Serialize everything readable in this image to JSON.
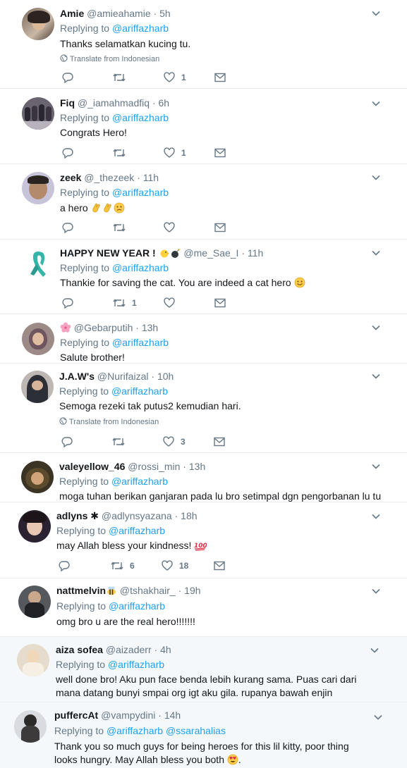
{
  "tweets": [
    {
      "name": "Amie",
      "handle": "@amieahamie",
      "time": "5h",
      "replying_label": "Replying to",
      "replying_to": "@ariffazharb",
      "text": "Thanks selamatkan kucing tu.",
      "translate": "Translate from Indonesian",
      "replies": "",
      "retweets": "",
      "likes": "1"
    },
    {
      "name": "Fiq",
      "handle": "@_iamahmadfiq",
      "time": "6h",
      "replying_label": "Replying to",
      "replying_to": "@ariffazharb",
      "text": "Congrats Hero!",
      "translate": "",
      "replies": "",
      "retweets": "",
      "likes": "1"
    },
    {
      "name": "zeek",
      "handle": "@_thezeek",
      "time": "11h",
      "replying_label": "Replying to",
      "replying_to": "@ariffazharb",
      "text": "a hero",
      "translate": "",
      "replies": "",
      "retweets": "",
      "likes": ""
    },
    {
      "name": "HAPPY NEW YEAR !",
      "handle": "@me_Sae_I",
      "time": "11h",
      "replying_label": "Replying to",
      "replying_to": "@ariffazharb",
      "text": "Thankie for saving the cat. You are indeed a cat hero",
      "translate": "",
      "replies": "",
      "retweets": "1",
      "likes": ""
    },
    {
      "name": "",
      "handle": "@Gebarputih",
      "time": "13h",
      "replying_label": "Replying to",
      "replying_to": "@ariffazharb",
      "text": "Salute brother!",
      "translate": "",
      "replies": "",
      "retweets": "",
      "likes": ""
    },
    {
      "name": "J.A.W's",
      "handle": "@Nurifaizal",
      "time": "10h",
      "replying_label": "Replying to",
      "replying_to": "@ariffazharb",
      "text": "Semoga rezeki tak putus2 kemudian hari.",
      "translate": "Translate from Indonesian",
      "replies": "",
      "retweets": "",
      "likes": "3"
    },
    {
      "name": "valeyellow_46",
      "handle": "@rossi_min",
      "time": "13h",
      "replying_label": "Replying to",
      "replying_to": "@ariffazharb",
      "text": "moga tuhan berikan ganjaran pada lu bro setimpal dgn pengorbanan lu tu",
      "translate": "",
      "replies": "",
      "retweets": "",
      "likes": ""
    },
    {
      "name": "adlyns",
      "handle": "@adlynsyazana",
      "time": "18h",
      "replying_label": "Replying to",
      "replying_to": "@ariffazharb",
      "text": "may Allah bless your kindness!",
      "translate": "",
      "replies": "",
      "retweets": "6",
      "likes": "18"
    },
    {
      "name": "nattmelvin",
      "handle": "@tshakhair_",
      "time": "19h",
      "replying_label": "Replying to",
      "replying_to": "@ariffazharb",
      "text": "omg bro u are the real hero!!!!!!!",
      "translate": "",
      "replies": "",
      "retweets": "",
      "likes": ""
    },
    {
      "name": "aiza sofea",
      "handle": "@aizaderr",
      "time": "4h",
      "replying_label": "Replying to",
      "replying_to": "@ariffazharb",
      "text": "well done bro! Aku pun face benda lebih kurang sama. Puas cari dari mana datang bunyi smpai org igt aku gila. rupanya bawah enjin",
      "translate": "",
      "replies": "",
      "retweets": "",
      "likes": ""
    },
    {
      "name": "puffercAt",
      "handle": "@vampydini",
      "time": "14h",
      "replying_label": "Replying to",
      "replying_to": "@ariffazharb",
      "replying_to_2": "@ssarahalias",
      "text": "Thank you so much guys for being heroes for this lil kitty, poor thing looks hungry. May Allah bless you both",
      "translate": "",
      "replies": "",
      "retweets": "",
      "likes": ""
    }
  ],
  "sep": "·",
  "colors": {
    "link": "#1da1f2",
    "muted": "#657786",
    "border": "#e6ecf0",
    "shaded": "#f5f8fa"
  }
}
